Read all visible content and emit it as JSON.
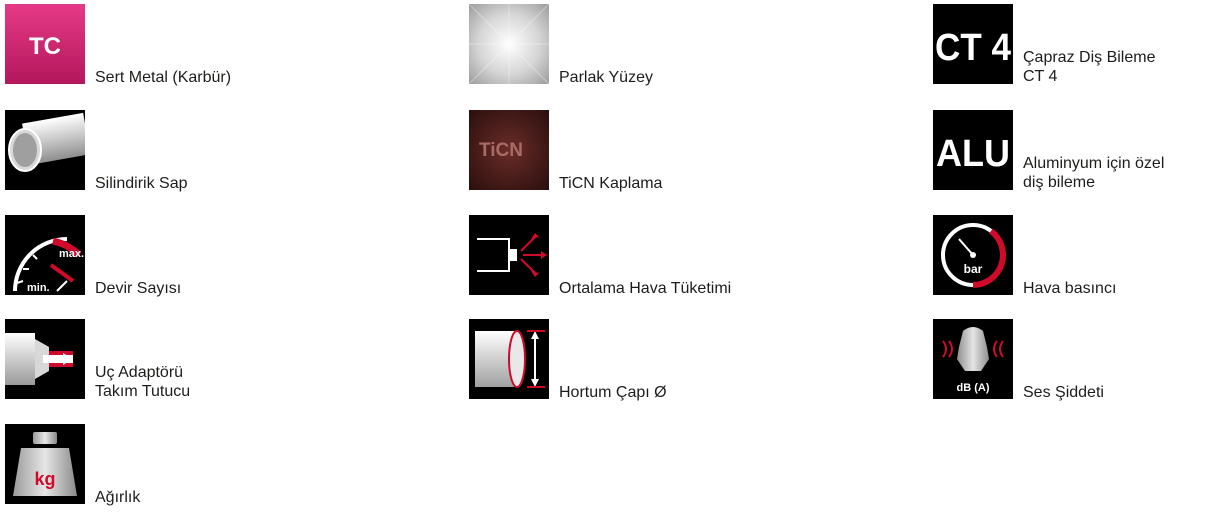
{
  "colors": {
    "brand_red": "#d10a2b",
    "icon_black": "#000000",
    "label_text": "#1d1d1b"
  },
  "items": [
    {
      "id": "hard-metal",
      "icon": "tc-carbide-icon",
      "icon_text": "TC",
      "label_lines": [
        "Sert Metal (Karbür)"
      ]
    },
    {
      "id": "cylindrical-shank",
      "icon": "cylindrical-shank-icon",
      "label_lines": [
        "Silindirik Sap"
      ]
    },
    {
      "id": "rpm",
      "icon": "rpm-gauge-icon",
      "icon_text_max": "max.",
      "icon_text_min": "min.",
      "label_lines": [
        "Devir Sayısı"
      ]
    },
    {
      "id": "tool-holder",
      "icon": "collet-adapter-icon",
      "label_lines": [
        "Uç Adaptörü",
        "Takım Tutucu"
      ]
    },
    {
      "id": "weight",
      "icon": "weight-kg-icon",
      "icon_text": "kg",
      "label_lines": [
        "Ağırlık"
      ]
    },
    {
      "id": "bright-surface",
      "icon": "bright-surface-icon",
      "label_lines": [
        "Parlak Yüzey"
      ]
    },
    {
      "id": "ticn-coating",
      "icon": "ticn-coating-icon",
      "icon_text": "TiCN",
      "label_lines": [
        "TiCN Kaplama"
      ]
    },
    {
      "id": "air-consumption",
      "icon": "air-consumption-icon",
      "label_lines": [
        "Ortalama Hava Tüketimi"
      ]
    },
    {
      "id": "hose-diameter",
      "icon": "hose-diameter-icon",
      "label_lines": [
        "Hortum Çapı Ø"
      ]
    },
    {
      "id": "cross-cut",
      "icon": "ct4-icon",
      "icon_text": "CT 4",
      "label_lines": [
        "Çapraz Diş Bileme",
        "CT 4"
      ]
    },
    {
      "id": "aluminium-cut",
      "icon": "alu-icon",
      "icon_text": "ALU",
      "label_lines": [
        "Aluminyum için özel",
        "diş bileme"
      ]
    },
    {
      "id": "air-pressure",
      "icon": "bar-gauge-icon",
      "icon_text": "bar",
      "label_lines": [
        "Hava basıncı"
      ]
    },
    {
      "id": "sound-level",
      "icon": "sound-level-icon",
      "icon_text": "dB (A)",
      "label_lines": [
        "Ses Şiddeti"
      ]
    }
  ]
}
